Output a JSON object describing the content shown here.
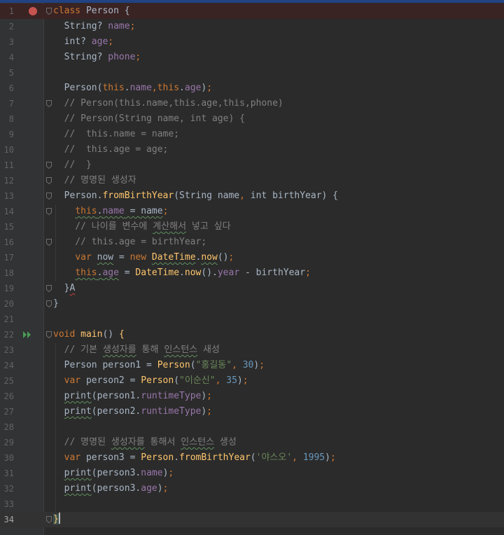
{
  "editor": {
    "lines": [
      {
        "n": "1",
        "tokens": [
          {
            "t": "class ",
            "c": "kw"
          },
          {
            "t": "Person {",
            "c": "pl"
          }
        ]
      },
      {
        "n": "2",
        "tokens": [
          {
            "t": "  String? ",
            "c": "pl"
          },
          {
            "t": "name",
            "c": "fld"
          },
          {
            "t": ";",
            "c": "kw"
          }
        ]
      },
      {
        "n": "3",
        "tokens": [
          {
            "t": "  int? ",
            "c": "pl"
          },
          {
            "t": "age",
            "c": "fld"
          },
          {
            "t": ";",
            "c": "kw"
          }
        ]
      },
      {
        "n": "4",
        "tokens": [
          {
            "t": "  String? ",
            "c": "pl"
          },
          {
            "t": "phone",
            "c": "fld"
          },
          {
            "t": ";",
            "c": "kw"
          }
        ]
      },
      {
        "n": "5",
        "tokens": []
      },
      {
        "n": "6",
        "tokens": [
          {
            "t": "  Person(",
            "c": "pl"
          },
          {
            "t": "this",
            "c": "kw"
          },
          {
            "t": ".",
            "c": "pl"
          },
          {
            "t": "name",
            "c": "fld"
          },
          {
            "t": ",",
            "c": "kw"
          },
          {
            "t": "this",
            "c": "kw"
          },
          {
            "t": ".",
            "c": "pl"
          },
          {
            "t": "age",
            "c": "fld"
          },
          {
            "t": ")",
            "c": "pl"
          },
          {
            "t": ";",
            "c": "kw"
          }
        ]
      },
      {
        "n": "7",
        "tokens": [
          {
            "t": "  // Person(this.name,this.age,this,phone)",
            "c": "cm"
          }
        ]
      },
      {
        "n": "8",
        "tokens": [
          {
            "t": "  // Person(String name, int age) {",
            "c": "cm"
          }
        ]
      },
      {
        "n": "9",
        "tokens": [
          {
            "t": "  //  this.name = name;",
            "c": "cm"
          }
        ]
      },
      {
        "n": "10",
        "tokens": [
          {
            "t": "  //  this.age = age;",
            "c": "cm"
          }
        ]
      },
      {
        "n": "11",
        "tokens": [
          {
            "t": "  //  }",
            "c": "cm"
          }
        ]
      },
      {
        "n": "12",
        "tokens": [
          {
            "t": "  // 명명된 생성자",
            "c": "cm"
          }
        ]
      },
      {
        "n": "13",
        "tokens": [
          {
            "t": "  Person.",
            "c": "pl"
          },
          {
            "t": "fromBirthYear",
            "c": "fn"
          },
          {
            "t": "(String name",
            "c": "pl"
          },
          {
            "t": ",",
            "c": "kw"
          },
          {
            "t": " int birthYear) {",
            "c": "pl"
          }
        ]
      },
      {
        "n": "14",
        "tokens": [
          {
            "t": "    ",
            "c": "pl"
          },
          {
            "t": "this",
            "c": "kw sq"
          },
          {
            "t": ".",
            "c": "pl sq"
          },
          {
            "t": "name",
            "c": "fld sq"
          },
          {
            "t": " = name",
            "c": "pl sq"
          },
          {
            "t": ";",
            "c": "kw"
          }
        ]
      },
      {
        "n": "15",
        "tokens": [
          {
            "t": "    // 나이를 변수에 ",
            "c": "cm"
          },
          {
            "t": "계산해서",
            "c": "cm sq"
          },
          {
            "t": " 넣고 싶다",
            "c": "cm"
          }
        ]
      },
      {
        "n": "16",
        "tokens": [
          {
            "t": "    // this.age = birthYear;",
            "c": "cm"
          }
        ]
      },
      {
        "n": "17",
        "tokens": [
          {
            "t": "    ",
            "c": "pl"
          },
          {
            "t": "var ",
            "c": "kw"
          },
          {
            "t": "now",
            "c": "pl sq"
          },
          {
            "t": " = ",
            "c": "pl"
          },
          {
            "t": "new ",
            "c": "kw"
          },
          {
            "t": "DateTime",
            "c": "fn sq"
          },
          {
            "t": ".",
            "c": "pl"
          },
          {
            "t": "now",
            "c": "fn sq"
          },
          {
            "t": "()",
            "c": "pl"
          },
          {
            "t": ";",
            "c": "kw"
          }
        ]
      },
      {
        "n": "18",
        "tokens": [
          {
            "t": "    ",
            "c": "pl"
          },
          {
            "t": "this",
            "c": "kw sq"
          },
          {
            "t": ".",
            "c": "pl sq"
          },
          {
            "t": "age",
            "c": "fld sq"
          },
          {
            "t": " = ",
            "c": "pl"
          },
          {
            "t": "DateTime",
            "c": "fn"
          },
          {
            "t": ".",
            "c": "pl"
          },
          {
            "t": "now",
            "c": "fn"
          },
          {
            "t": "().",
            "c": "pl"
          },
          {
            "t": "year",
            "c": "fld"
          },
          {
            "t": " - birthYear",
            "c": "pl"
          },
          {
            "t": ";",
            "c": "kw"
          }
        ]
      },
      {
        "n": "19",
        "tokens": [
          {
            "t": "  }",
            "c": "pl"
          },
          {
            "t": "A",
            "c": "pl sqr"
          }
        ]
      },
      {
        "n": "20",
        "tokens": [
          {
            "t": "}",
            "c": "pl"
          }
        ]
      },
      {
        "n": "21",
        "tokens": []
      },
      {
        "n": "22",
        "tokens": [
          {
            "t": "void ",
            "c": "kw"
          },
          {
            "t": "main",
            "c": "fn"
          },
          {
            "t": "() ",
            "c": "pl"
          },
          {
            "t": "{",
            "c": "fn"
          }
        ]
      },
      {
        "n": "23",
        "tokens": [
          {
            "t": "  // 기본 ",
            "c": "cm"
          },
          {
            "t": "생성자를",
            "c": "cm sq"
          },
          {
            "t": " 통해 ",
            "c": "cm"
          },
          {
            "t": "인스턴스",
            "c": "cm sq"
          },
          {
            "t": " 새성",
            "c": "cm"
          }
        ]
      },
      {
        "n": "24",
        "tokens": [
          {
            "t": "  Person person1 = ",
            "c": "pl"
          },
          {
            "t": "Person",
            "c": "fn"
          },
          {
            "t": "(",
            "c": "pl"
          },
          {
            "t": "\"홍길동\"",
            "c": "str"
          },
          {
            "t": ", ",
            "c": "kw"
          },
          {
            "t": "30",
            "c": "num"
          },
          {
            "t": ")",
            "c": "pl"
          },
          {
            "t": ";",
            "c": "kw"
          }
        ]
      },
      {
        "n": "25",
        "tokens": [
          {
            "t": "  ",
            "c": "pl"
          },
          {
            "t": "var ",
            "c": "kw"
          },
          {
            "t": "person2 = ",
            "c": "pl"
          },
          {
            "t": "Person",
            "c": "fn"
          },
          {
            "t": "(",
            "c": "pl"
          },
          {
            "t": "\"이순신\"",
            "c": "str"
          },
          {
            "t": ", ",
            "c": "kw"
          },
          {
            "t": "35",
            "c": "num"
          },
          {
            "t": ")",
            "c": "pl"
          },
          {
            "t": ";",
            "c": "kw"
          }
        ]
      },
      {
        "n": "26",
        "tokens": [
          {
            "t": "  ",
            "c": "pl"
          },
          {
            "t": "print",
            "c": "pl sq"
          },
          {
            "t": "(person1.",
            "c": "pl"
          },
          {
            "t": "runtimeType",
            "c": "fld"
          },
          {
            "t": ")",
            "c": "pl"
          },
          {
            "t": ";",
            "c": "kw"
          }
        ]
      },
      {
        "n": "27",
        "tokens": [
          {
            "t": "  ",
            "c": "pl"
          },
          {
            "t": "print",
            "c": "pl sq"
          },
          {
            "t": "(person2.",
            "c": "pl"
          },
          {
            "t": "runtimeType",
            "c": "fld"
          },
          {
            "t": ")",
            "c": "pl"
          },
          {
            "t": ";",
            "c": "kw"
          }
        ]
      },
      {
        "n": "28",
        "tokens": []
      },
      {
        "n": "29",
        "tokens": [
          {
            "t": "  // 명명된 ",
            "c": "cm"
          },
          {
            "t": "생성자를",
            "c": "cm sq"
          },
          {
            "t": " 통해서 ",
            "c": "cm"
          },
          {
            "t": "인스턴스",
            "c": "cm sq"
          },
          {
            "t": " 생성",
            "c": "cm"
          }
        ]
      },
      {
        "n": "30",
        "tokens": [
          {
            "t": "  ",
            "c": "pl"
          },
          {
            "t": "var ",
            "c": "kw"
          },
          {
            "t": "person3 = ",
            "c": "pl"
          },
          {
            "t": "Person",
            "c": "fn"
          },
          {
            "t": ".",
            "c": "pl"
          },
          {
            "t": "fromBirthYear",
            "c": "fn"
          },
          {
            "t": "(",
            "c": "pl"
          },
          {
            "t": "'야스오'",
            "c": "str"
          },
          {
            "t": ", ",
            "c": "kw"
          },
          {
            "t": "1995",
            "c": "num"
          },
          {
            "t": ")",
            "c": "pl"
          },
          {
            "t": ";",
            "c": "kw"
          }
        ]
      },
      {
        "n": "31",
        "tokens": [
          {
            "t": "  ",
            "c": "pl"
          },
          {
            "t": "print",
            "c": "pl sq"
          },
          {
            "t": "(person3.",
            "c": "pl"
          },
          {
            "t": "name",
            "c": "fld"
          },
          {
            "t": ")",
            "c": "pl"
          },
          {
            "t": ";",
            "c": "kw"
          }
        ]
      },
      {
        "n": "32",
        "tokens": [
          {
            "t": "  ",
            "c": "pl"
          },
          {
            "t": "print",
            "c": "pl sq"
          },
          {
            "t": "(person3.",
            "c": "pl"
          },
          {
            "t": "age",
            "c": "fld"
          },
          {
            "t": ")",
            "c": "pl"
          },
          {
            "t": ";",
            "c": "kw"
          }
        ]
      },
      {
        "n": "33",
        "tokens": []
      },
      {
        "n": "34",
        "tokens": [
          {
            "t": "}",
            "c": "fn hl"
          }
        ]
      }
    ],
    "breakpoint_line": "1",
    "run_line": "22",
    "caret_line": "34",
    "fold_markers": [
      "1",
      "7",
      "11",
      "12",
      "13",
      "14",
      "16",
      "19",
      "20",
      "22",
      "34"
    ],
    "icons": {
      "breakpoint": "breakpoint-icon",
      "run": "run-gutter-icon",
      "fold": "fold-icon"
    },
    "colors": {
      "background": "#2b2b2b",
      "gutter": "#313335",
      "keyword": "#cc7832",
      "field": "#9876aa",
      "function": "#ffc66d",
      "string": "#6a8759",
      "number": "#6897bb",
      "comment": "#808080",
      "text": "#a9b7c6",
      "breakpoint": "#c75450",
      "run": "#499c54"
    }
  }
}
